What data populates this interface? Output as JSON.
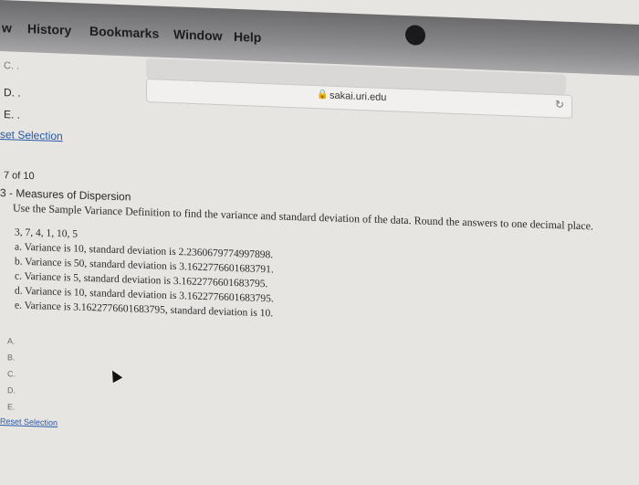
{
  "menubar": {
    "items": [
      "w",
      "History",
      "Bookmarks",
      "Window",
      "Help"
    ]
  },
  "browser": {
    "url": "sakai.uri.edu",
    "lock_icon": "lock-icon",
    "reload_icon": "reload-icon"
  },
  "prev_question": {
    "options": [
      "D. .",
      "E. ."
    ],
    "reset_label": "set Selection"
  },
  "question": {
    "counter": "7 of 10",
    "topic": "3 - Measures of Dispersion",
    "prompt": "Use the Sample Variance Definition to find the variance and standard deviation of the data. Round the answers to one decimal place.",
    "data": "3, 7, 4, 1, 10, 5",
    "choices": [
      "a. Variance is 10, standard deviation is 2.2360679774997898.",
      "b. Variance is 50, standard deviation is 3.1622776601683791.",
      "c. Variance is 5, standard deviation is 3.1622776601683795.",
      "d. Variance is 10, standard deviation is 3.1622776601683795.",
      "e. Variance is 3.1622776601683795, standard deviation is 10."
    ],
    "options": [
      "A.",
      "B.",
      "C.",
      "D.",
      "E."
    ],
    "reset_label": "Reset Selection"
  }
}
